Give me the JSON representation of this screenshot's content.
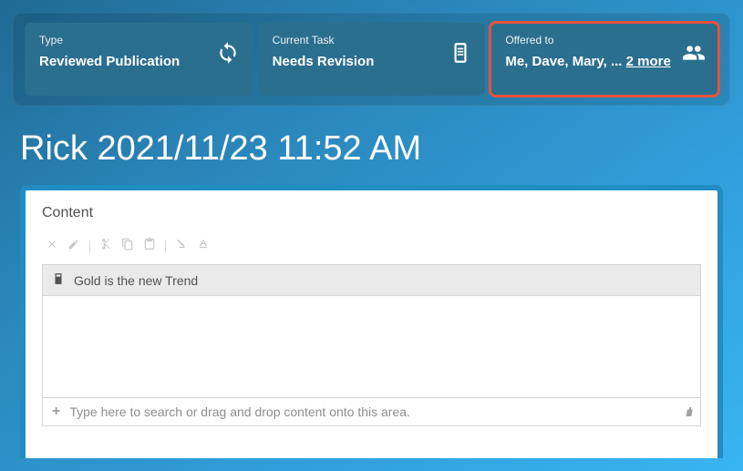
{
  "cards": {
    "type": {
      "label": "Type",
      "value": "Reviewed Publication"
    },
    "task": {
      "label": "Current Task",
      "value": "Needs Revision"
    },
    "offered": {
      "label": "Offered to",
      "value": "Me, Dave, Mary, ... ",
      "more": "2 more"
    }
  },
  "page_title": "Rick 2021/11/23 11:52 AM",
  "content": {
    "heading": "Content",
    "item_title": "Gold is the new Trend",
    "search_placeholder": "Type here to search or drag and drop content onto this area."
  }
}
